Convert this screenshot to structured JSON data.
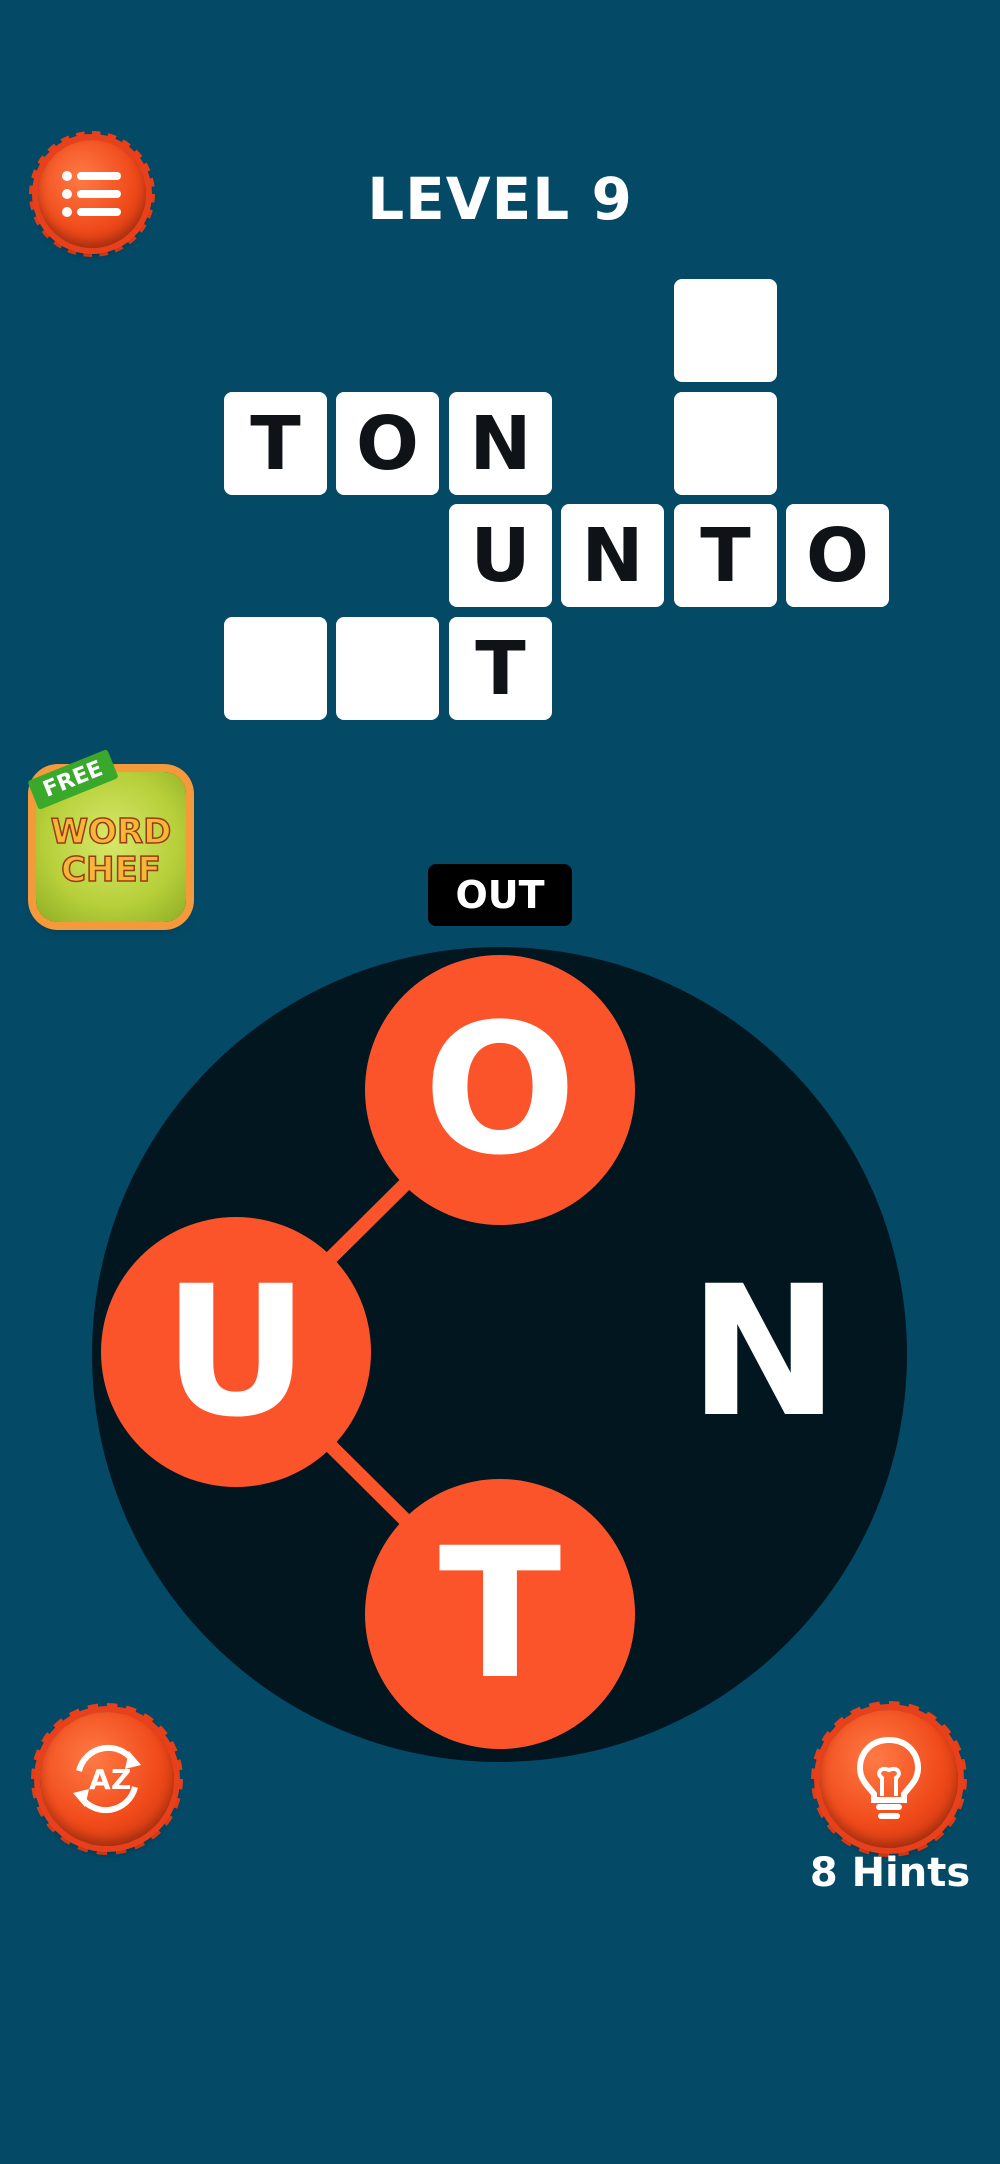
{
  "header": {
    "level_title": "LEVEL 9"
  },
  "grid": {
    "words_found": [
      "TON",
      "UNTO",
      "NUT"
    ],
    "cells": [
      {
        "letter": "T"
      },
      {
        "letter": "O"
      },
      {
        "letter": "N"
      },
      {
        "letter": "U"
      },
      {
        "letter": "N"
      },
      {
        "letter": "T"
      },
      {
        "letter": "O"
      },
      {
        "letter": "T"
      },
      {
        "letter": ""
      },
      {
        "letter": ""
      },
      {
        "letter": ""
      },
      {
        "letter": ""
      }
    ]
  },
  "promo": {
    "badge": "FREE",
    "line1": "WORD",
    "line2": "CHEF"
  },
  "current_word": "OUT",
  "wheel": {
    "letters": [
      {
        "letter": "O",
        "selected": true
      },
      {
        "letter": "U",
        "selected": true
      },
      {
        "letter": "N",
        "selected": false
      },
      {
        "letter": "T",
        "selected": true
      }
    ],
    "selected_color": "#fb542b"
  },
  "hints": {
    "label": "8 Hints"
  },
  "colors": {
    "background": "#044a67",
    "accent": "#f04a1a",
    "wheel": "#021620"
  },
  "icons": {
    "menu": "list-icon",
    "shuffle": "a-z-shuffle-icon",
    "hint": "lightbulb-icon"
  }
}
